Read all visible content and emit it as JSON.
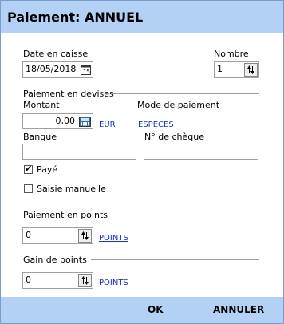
{
  "window": {
    "title": "Paiement: ANNUEL"
  },
  "date": {
    "label": "Date en caisse",
    "value": "18/05/2018"
  },
  "count": {
    "label": "Nombre",
    "value": "1"
  },
  "foreign": {
    "section_label": "Paiement en devises",
    "amount_label": "Montant",
    "amount_value": "0,00",
    "currency_link": "EUR",
    "mode_label": "Mode de paiement",
    "mode_link": "ESPECES",
    "bank_label": "Banque",
    "bank_value": "",
    "cheque_label": "N° de chèque",
    "cheque_value": ""
  },
  "paid": {
    "label": "Payé",
    "checked": true
  },
  "manual": {
    "label": "Saisie manuelle",
    "checked": false
  },
  "points_payment": {
    "section_label": "Paiement en points",
    "value": "0",
    "link": "POINTS"
  },
  "points_gain": {
    "section_label": "Gain de points",
    "value": "0",
    "link": "POINTS"
  },
  "footer": {
    "ok_label": "OK",
    "cancel_label": "ANNULER"
  },
  "colors": {
    "title_bar": "#b3d1f5",
    "link": "#1a33c8"
  }
}
